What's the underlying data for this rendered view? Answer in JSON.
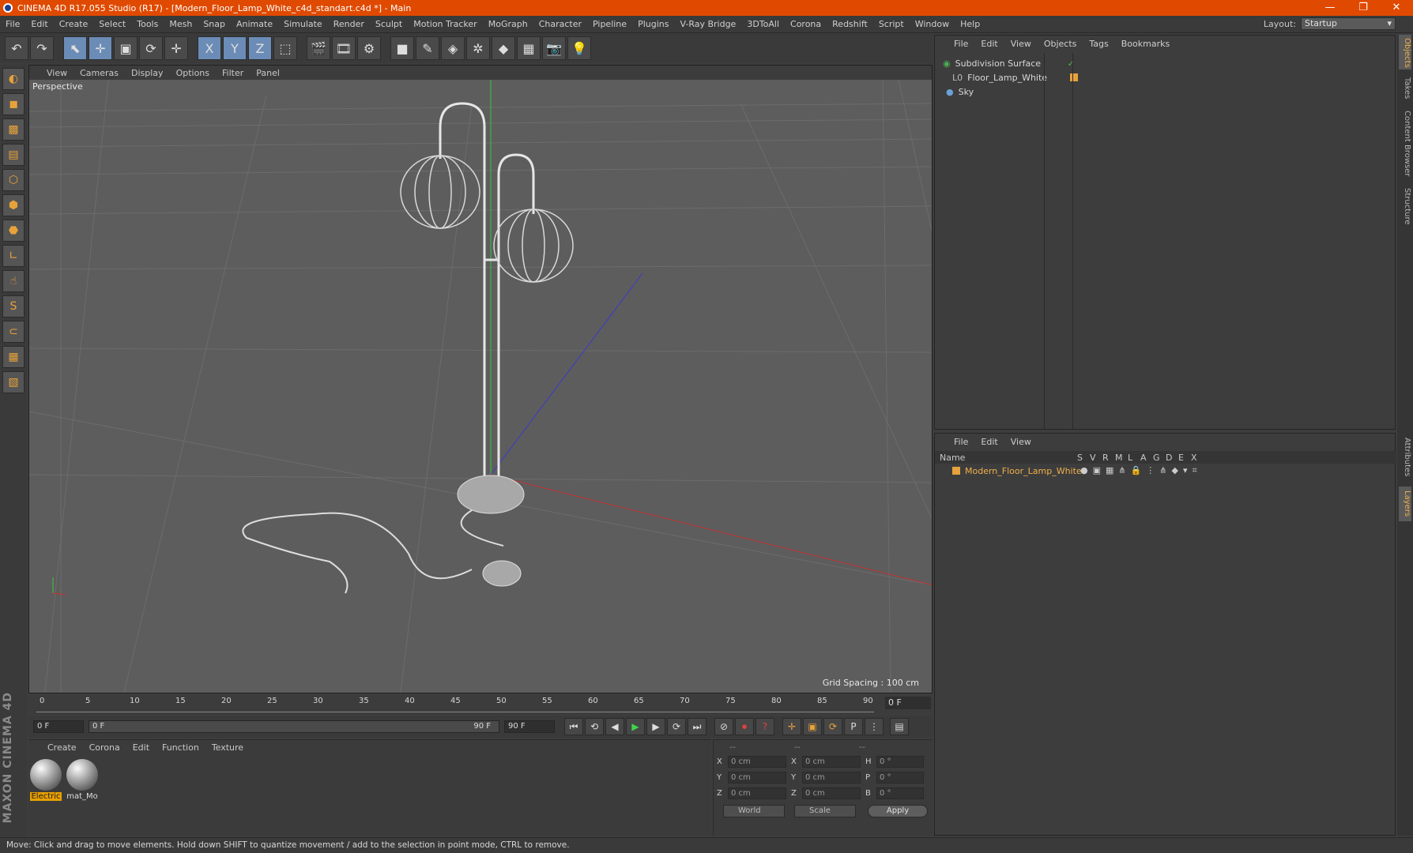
{
  "window": {
    "title": "CINEMA 4D R17.055 Studio (R17) - [Modern_Floor_Lamp_White_c4d_standart.c4d *] - Main",
    "minimize": "—",
    "restore": "❐",
    "close": "✕"
  },
  "menu": [
    "File",
    "Edit",
    "Create",
    "Select",
    "Tools",
    "Mesh",
    "Snap",
    "Animate",
    "Simulate",
    "Render",
    "Sculpt",
    "Motion Tracker",
    "MoGraph",
    "Character",
    "Pipeline",
    "Plugins",
    "V-Ray Bridge",
    "3DToAll",
    "Corona",
    "Redshift",
    "Script",
    "Window",
    "Help"
  ],
  "layout": {
    "label": "Layout:",
    "value": "Startup"
  },
  "toolbar": {
    "undo": "↶",
    "redo": "↷",
    "select": "⬉",
    "move": "✛",
    "scale": "▣",
    "rotate": "⟳",
    "transform": "✛",
    "x": "X",
    "y": "Y",
    "z": "Z",
    "coord": "⬚",
    "render_view": "🎬",
    "render_pic": "🎞",
    "render_settings": "⚙",
    "cube": "■",
    "pen": "✎",
    "subdiv": "◈",
    "array": "✲",
    "deformer": "◆",
    "floor": "▦",
    "camera": "📷",
    "light": "💡"
  },
  "viewport": {
    "menu": [
      "View",
      "Cameras",
      "Display",
      "Options",
      "Filter",
      "Panel"
    ],
    "label": "Perspective",
    "grid_spacing": "Grid Spacing : 100 cm"
  },
  "timeline": {
    "ticks": [
      "0",
      "5",
      "10",
      "15",
      "20",
      "25",
      "30",
      "35",
      "40",
      "45",
      "50",
      "55",
      "60",
      "65",
      "70",
      "75",
      "80",
      "85",
      "90"
    ],
    "current_frame": "0 F"
  },
  "transport": {
    "start": "0 F",
    "range_start": "0 F",
    "range_end": "90 F",
    "end": "90 F"
  },
  "materials": {
    "menu": [
      "Create",
      "Corona",
      "Edit",
      "Function",
      "Texture"
    ],
    "items": [
      {
        "label": "Electric",
        "selected": true
      },
      {
        "label": "mat_Mo",
        "selected": false
      }
    ]
  },
  "coords": {
    "headers": [
      "--",
      "--",
      "--"
    ],
    "rows": [
      {
        "a": "X",
        "av": "0 cm",
        "b": "X",
        "bv": "0 cm",
        "c": "H",
        "cv": "0 °"
      },
      {
        "a": "Y",
        "av": "0 cm",
        "b": "Y",
        "bv": "0 cm",
        "c": "P",
        "cv": "0 °"
      },
      {
        "a": "Z",
        "av": "0 cm",
        "b": "Z",
        "bv": "0 cm",
        "c": "B",
        "cv": "0 °"
      }
    ],
    "space": "World",
    "mode": "Scale",
    "apply": "Apply"
  },
  "object_manager": {
    "menu": [
      "File",
      "Edit",
      "View",
      "Objects",
      "Tags",
      "Bookmarks"
    ],
    "objects": [
      {
        "name": "Subdivision Surface",
        "color": "#4caf50"
      },
      {
        "name": "Floor_Lamp_White",
        "color": "#e6a23c"
      },
      {
        "name": "Sky",
        "color": "#6aa0d8"
      }
    ]
  },
  "layers": {
    "menu": [
      "File",
      "Edit",
      "View"
    ],
    "columns": [
      "Name",
      "S",
      "V",
      "R",
      "M",
      "L",
      "A",
      "G",
      "D",
      "E",
      "X"
    ],
    "rows": [
      {
        "name": "Modern_Floor_Lamp_White",
        "color": "#e6a23c"
      }
    ]
  },
  "side_tabs": [
    "Objects",
    "Takes",
    "Content Browser",
    "Structure",
    "Attributes",
    "Layers"
  ],
  "status": "Move: Click and drag to move elements. Hold down SHIFT to quantize movement / add to the selection in point mode, CTRL to remove.",
  "brand": "MAXON CINEMA 4D"
}
